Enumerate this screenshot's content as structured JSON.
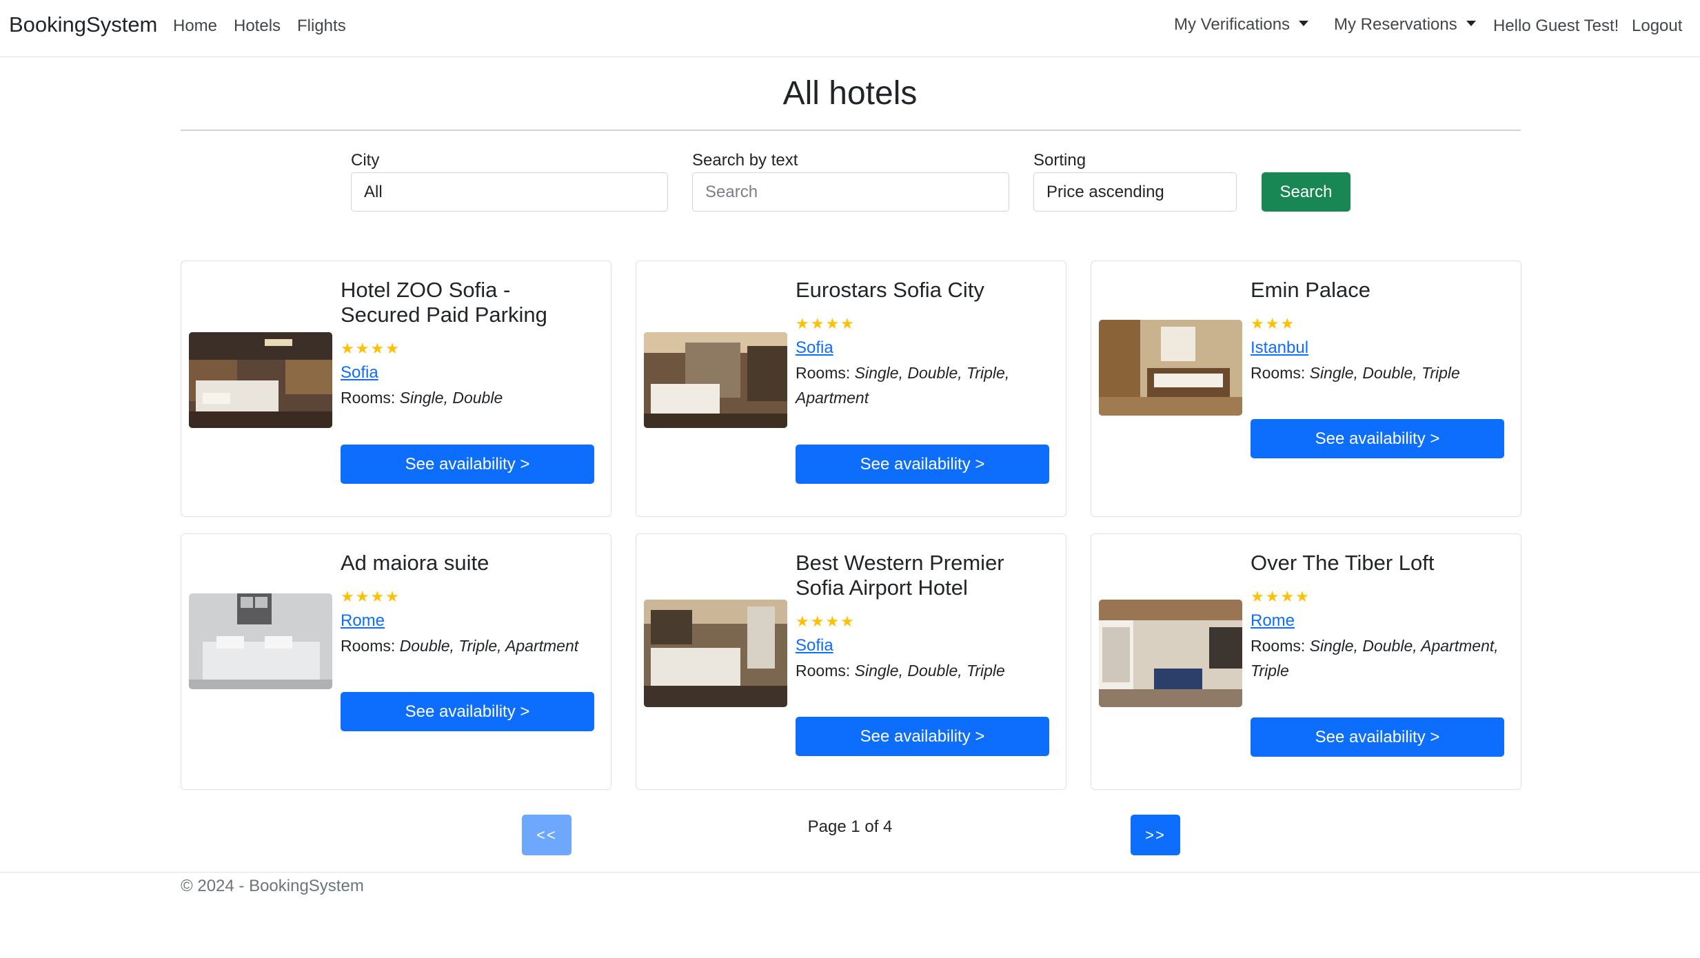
{
  "nav": {
    "brand": "BookingSystem",
    "home": "Home",
    "hotels": "Hotels",
    "flights": "Flights",
    "verifications": "My Verifications",
    "reservations": "My Reservations",
    "greeting": "Hello Guest Test!",
    "logout": "Logout"
  },
  "page": {
    "title": "All hotels"
  },
  "filters": {
    "city_label": "City",
    "city_value": "All",
    "text_label": "Search by text",
    "text_placeholder": "Search",
    "sort_label": "Sorting",
    "sort_value": "Price ascending",
    "search_button": "Search"
  },
  "hotels": [
    {
      "name": "Hotel ZOO Sofia - Secured Paid Parking",
      "stars": "★★★★",
      "rating": 4,
      "city": "Sofia",
      "rooms_label": "Rooms: ",
      "rooms": "Single, Double",
      "button": "See availability >"
    },
    {
      "name": "Eurostars Sofia City",
      "stars": "★★★★",
      "rating": 4,
      "city": "Sofia",
      "rooms_label": "Rooms: ",
      "rooms": "Single, Double, Triple, Apartment",
      "button": "See availability >"
    },
    {
      "name": "Emin Palace",
      "stars": "★★★",
      "rating": 3,
      "city": "Istanbul",
      "rooms_label": "Rooms: ",
      "rooms": "Single, Double, Triple",
      "button": "See availability >"
    },
    {
      "name": "Ad maiora suite",
      "stars": "★★★★",
      "rating": 4,
      "city": "Rome",
      "rooms_label": "Rooms: ",
      "rooms": "Double, Triple, Apartment",
      "button": "See availability >"
    },
    {
      "name": "Best Western Premier Sofia Airport Hotel",
      "stars": "★★★★",
      "rating": 4,
      "city": "Sofia",
      "rooms_label": "Rooms: ",
      "rooms": "Single, Double, Triple",
      "button": "See availability >"
    },
    {
      "name": "Over The Tiber Loft",
      "stars": "★★★★",
      "rating": 4,
      "city": "Rome",
      "rooms_label": "Rooms: ",
      "rooms": "Single, Double, Apartment, Triple",
      "button": "See availability >"
    }
  ],
  "pagination": {
    "prev": "<<",
    "next": ">>",
    "info": "Page 1 of 4"
  },
  "footer": {
    "text": "© 2024 - BookingSystem"
  },
  "colors": {
    "primary": "#0d6efd",
    "primary_disabled": "#6ea8fe",
    "success": "#198754",
    "star": "#ffc107",
    "link": "#0d6efd"
  }
}
